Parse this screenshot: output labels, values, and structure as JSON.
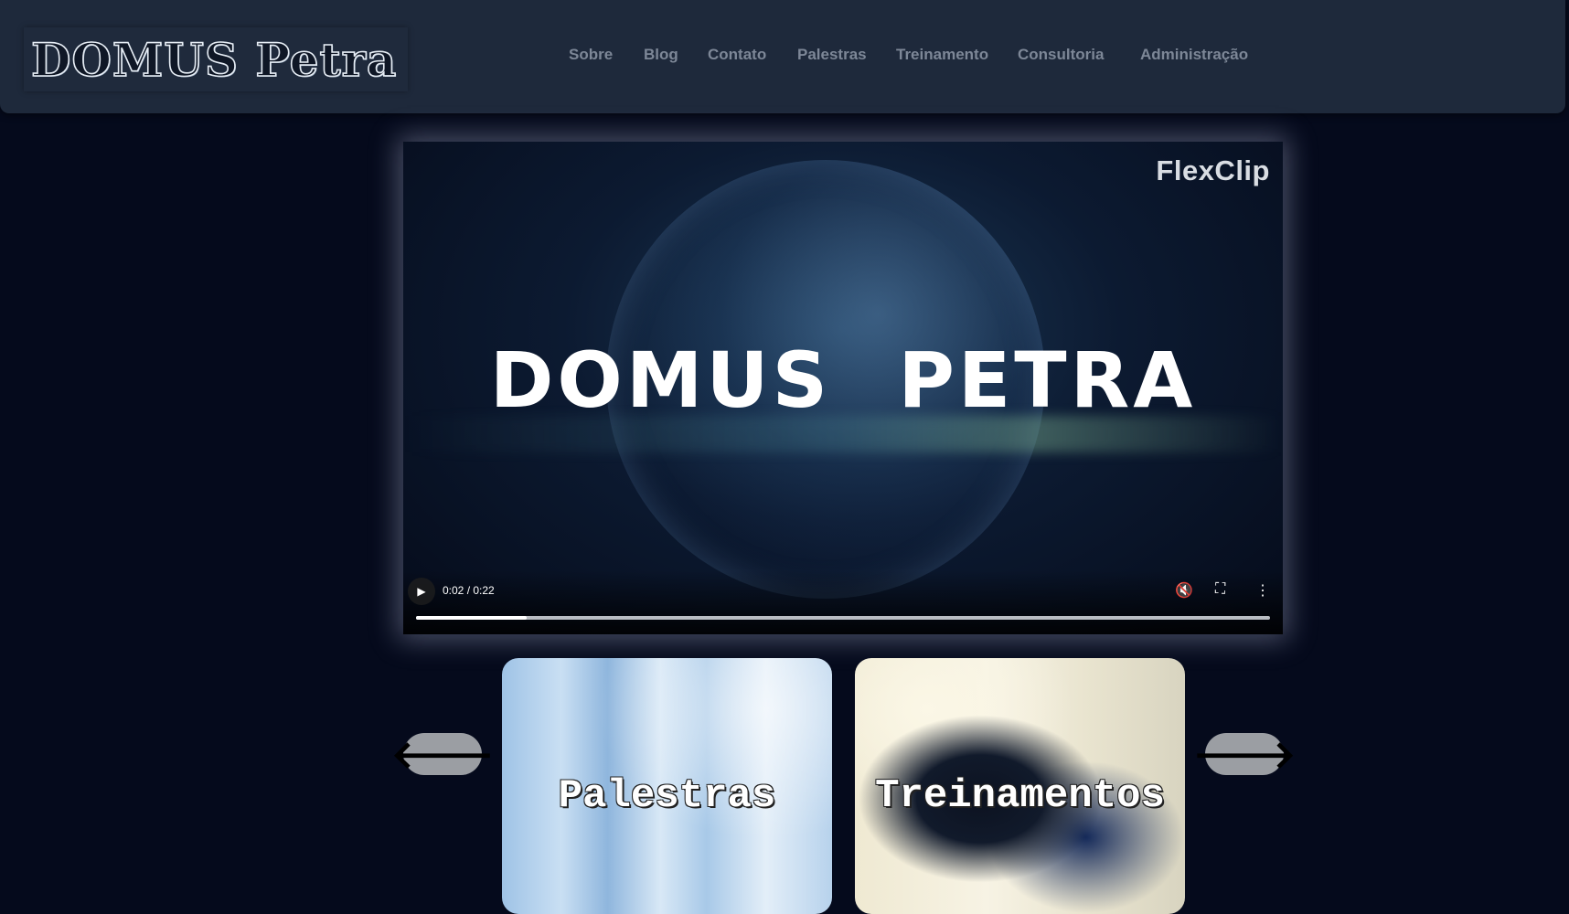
{
  "header": {
    "logo_text": "DOMUS Petra",
    "nav": [
      {
        "label": "Sobre"
      },
      {
        "label": "Blog"
      },
      {
        "label": "Contato"
      },
      {
        "label": "Palestras"
      },
      {
        "label": "Treinamento"
      },
      {
        "label": "Consultoria"
      },
      {
        "label": "Administração"
      }
    ]
  },
  "video": {
    "watermark": "FlexClip",
    "title": "DOMUS PETRA",
    "time_display": "0:02 / 0:22",
    "progress_fraction": 0.13,
    "icons": {
      "play": "play-icon",
      "mute": "volume-muted-icon",
      "fullscreen": "fullscreen-icon",
      "more": "more-options-icon"
    }
  },
  "carousel": {
    "prev_icon": "arrow-left-icon",
    "next_icon": "arrow-right-icon",
    "cards": [
      {
        "title": "Palestras"
      },
      {
        "title": "Treinamentos"
      }
    ]
  }
}
